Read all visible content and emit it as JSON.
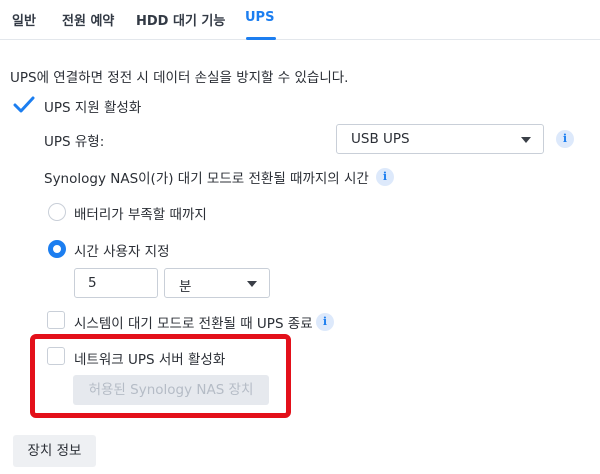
{
  "tabs": [
    {
      "label": "일반"
    },
    {
      "label": "전원 예약"
    },
    {
      "label": "HDD 대기 기능"
    },
    {
      "label": "UPS",
      "active": true
    }
  ],
  "description": "UPS에 연결하면 정전 시 데이터 손실을 방지할 수 있습니다.",
  "ups_support": {
    "label": "UPS 지원 활성화",
    "checked": true
  },
  "ups_type": {
    "label": "UPS 유형:",
    "value": "USB UPS"
  },
  "standby_time": {
    "label": "Synology NAS이(가) 대기 모드로 전환될 때까지의 시간",
    "options": [
      {
        "label": "배터리가 부족할 때까지",
        "selected": false
      },
      {
        "label": "시간 사용자 지정",
        "selected": true
      }
    ],
    "custom_value": "5",
    "unit": "분"
  },
  "shutdown_ups": {
    "label": "시스템이 대기 모드로 전환될 때 UPS 종료",
    "checked": false
  },
  "network_ups": {
    "label": "네트워크 UPS 서버 활성화",
    "checked": false
  },
  "allowed_devices_button": "허용된 Synology NAS 장치",
  "device_info_button": "장치 정보",
  "icons": {
    "info": "i"
  },
  "colors": {
    "accent": "#1c7ef0",
    "highlight": "#e3101a"
  }
}
